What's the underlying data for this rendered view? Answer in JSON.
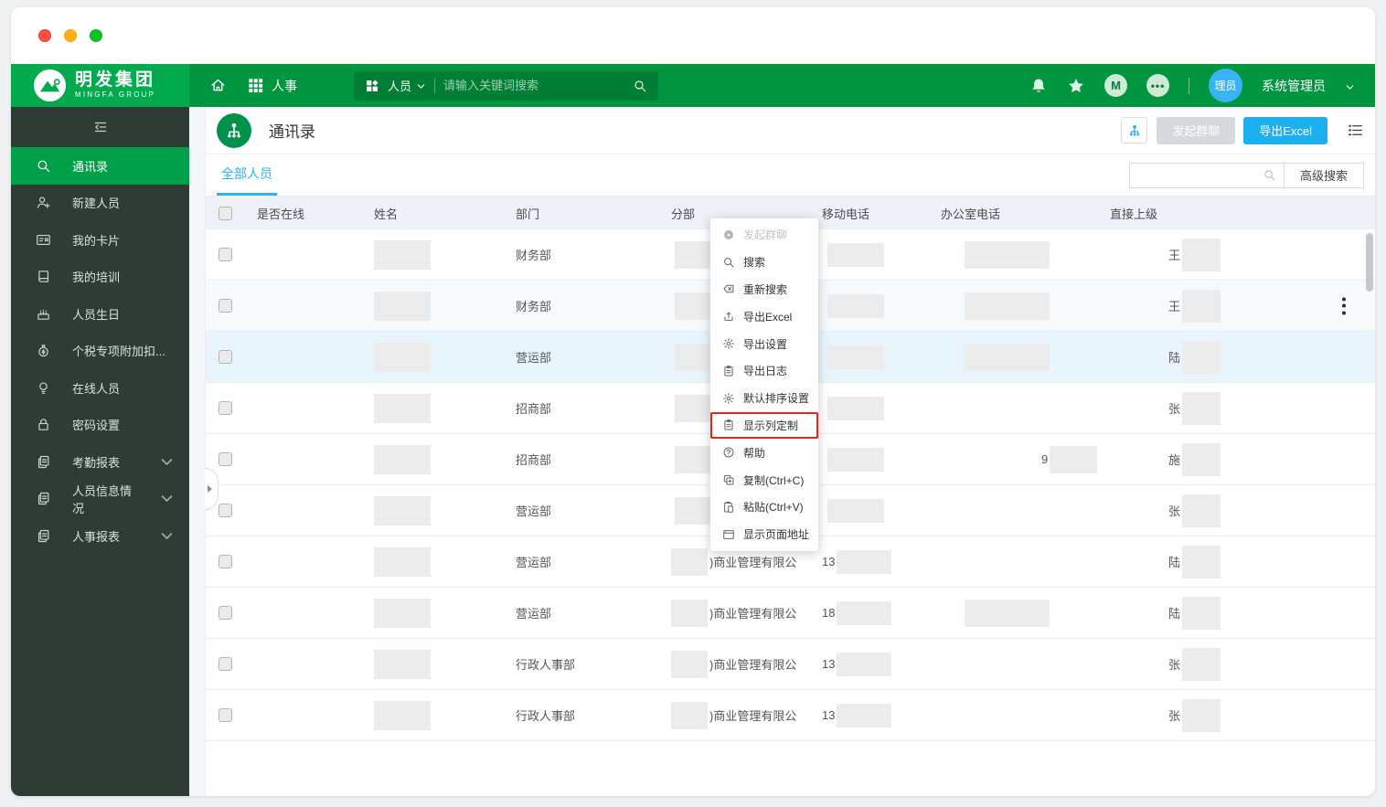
{
  "colors": {
    "brand_green": "#00953F",
    "logo_green": "#00AA4D",
    "accent_blue": "#2AB2F2",
    "sidebar_dark": "#2F3C35",
    "highlight_red": "#E5261F"
  },
  "topnav": {
    "logo": {
      "title": "明发集团",
      "subtitle": "MINGFA GROUP"
    },
    "module_label": "人事",
    "search": {
      "scope": "人员",
      "placeholder": "请输入关键词搜索",
      "value": ""
    },
    "user": {
      "avatar_text": "理员",
      "name": "系统管理员"
    }
  },
  "sidebar": {
    "items": [
      {
        "label": "通讯录",
        "icon": "search",
        "active": true,
        "expandable": false
      },
      {
        "label": "新建人员",
        "icon": "person-add",
        "active": false,
        "expandable": false
      },
      {
        "label": "我的卡片",
        "icon": "id-card",
        "active": false,
        "expandable": false
      },
      {
        "label": "我的培训",
        "icon": "book",
        "active": false,
        "expandable": false
      },
      {
        "label": "人员生日",
        "icon": "cake",
        "active": false,
        "expandable": false
      },
      {
        "label": "个税专项附加扣...",
        "icon": "money-bag",
        "active": false,
        "expandable": false
      },
      {
        "label": "在线人员",
        "icon": "bulb",
        "active": false,
        "expandable": false
      },
      {
        "label": "密码设置",
        "icon": "lock",
        "active": false,
        "expandable": false
      },
      {
        "label": "考勤报表",
        "icon": "report",
        "active": false,
        "expandable": true
      },
      {
        "label": "人员信息情况",
        "icon": "report",
        "active": false,
        "expandable": true
      },
      {
        "label": "人事报表",
        "icon": "report",
        "active": false,
        "expandable": true
      }
    ]
  },
  "content": {
    "page_title": "通讯录",
    "tab_label": "全部人员",
    "buttons": {
      "group_chat": "发起群聊",
      "export_excel": "导出Excel",
      "advanced_search": "高级搜索"
    },
    "filter": {
      "value": ""
    }
  },
  "table": {
    "headers": [
      "是否在线",
      "姓名",
      "部门",
      "分部",
      "移动电话",
      "办公室电话",
      "直接上级"
    ],
    "rows": [
      {
        "dept": "财务部",
        "branch": "",
        "mobile": "",
        "office": "",
        "office_blur": true,
        "supervisor": "王",
        "bg": "white",
        "kebab": false
      },
      {
        "dept": "财务部",
        "branch": "",
        "mobile": "",
        "office": "",
        "office_blur": true,
        "supervisor": "王",
        "bg": "stripe",
        "kebab": true
      },
      {
        "dept": "营运部",
        "branch": "",
        "mobile": "",
        "office": "",
        "office_blur": true,
        "supervisor": "陆",
        "bg": "hover",
        "kebab": false
      },
      {
        "dept": "招商部",
        "branch": "",
        "mobile": "",
        "office": "",
        "office_blur": false,
        "supervisor": "张",
        "bg": "white",
        "kebab": false
      },
      {
        "dept": "招商部",
        "branch": "",
        "mobile": "",
        "office": "9",
        "office_blur": true,
        "supervisor": "施",
        "bg": "white",
        "kebab": false
      },
      {
        "dept": "营运部",
        "branch": "",
        "mobile": "",
        "office": "",
        "office_blur": false,
        "supervisor": "张",
        "bg": "white",
        "kebab": false
      },
      {
        "dept": "营运部",
        "branch": ")商业管理有限公",
        "mobile": "13",
        "office": "",
        "office_blur": false,
        "supervisor": "陆",
        "bg": "white",
        "kebab": false
      },
      {
        "dept": "营运部",
        "branch": ")商业管理有限公",
        "mobile": "18",
        "office": "",
        "office_blur": true,
        "supervisor": "陆",
        "bg": "white",
        "kebab": false
      },
      {
        "dept": "行政人事部",
        "branch": ")商业管理有限公",
        "mobile": "13",
        "office": "",
        "office_blur": false,
        "supervisor": "张",
        "bg": "white",
        "kebab": false
      },
      {
        "dept": "行政人事部",
        "branch": ")商业管理有限公",
        "mobile": "13",
        "office": "",
        "office_blur": false,
        "supervisor": "张",
        "bg": "white",
        "kebab": false
      }
    ]
  },
  "context_menu": {
    "items": [
      {
        "label": "发起群聊",
        "icon": "chat-dot",
        "disabled": true,
        "highlighted": false
      },
      {
        "label": "搜索",
        "icon": "search",
        "disabled": false,
        "highlighted": false
      },
      {
        "label": "重新搜索",
        "icon": "backspace",
        "disabled": false,
        "highlighted": false
      },
      {
        "label": "导出Excel",
        "icon": "export",
        "disabled": false,
        "highlighted": false
      },
      {
        "label": "导出设置",
        "icon": "gear",
        "disabled": false,
        "highlighted": false
      },
      {
        "label": "导出日志",
        "icon": "clipboard",
        "disabled": false,
        "highlighted": false
      },
      {
        "label": "默认排序设置",
        "icon": "gear",
        "disabled": false,
        "highlighted": false
      },
      {
        "label": "显示列定制",
        "icon": "clipboard",
        "disabled": false,
        "highlighted": true
      },
      {
        "label": "帮助",
        "icon": "question",
        "disabled": false,
        "highlighted": false
      },
      {
        "label": "复制(Ctrl+C)",
        "icon": "copy",
        "disabled": false,
        "highlighted": false
      },
      {
        "label": "粘贴(Ctrl+V)",
        "icon": "paste",
        "disabled": false,
        "highlighted": false
      },
      {
        "label": "显示页面地址",
        "icon": "window",
        "disabled": false,
        "highlighted": false
      }
    ]
  }
}
